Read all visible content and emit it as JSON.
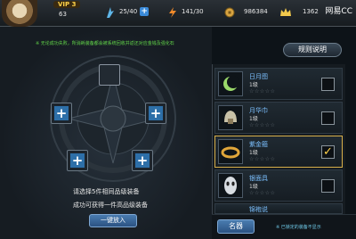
{
  "header": {
    "vip": "VIP 3",
    "level": "63",
    "stamina": "25/40",
    "energy": "141/30",
    "gold": "986384",
    "diamonds": "1362",
    "plus": "+",
    "watermark": "网易CC"
  },
  "forge": {
    "notice": "※ 无论成功失败，所消耗装备都会被系统回收并返还对应金钱及强化石",
    "tip_line1": "请选择5件相同品级装备",
    "tip_line2": "成功可获得一件高品级装备",
    "place_button": "一键放入",
    "slot_plus": "+"
  },
  "rules_button": "规则说明",
  "equipment_list": [
    {
      "name": "日月图",
      "level": "1级",
      "stars": "☆☆☆☆☆",
      "checked": false,
      "check": ""
    },
    {
      "name": "月华巾",
      "level": "1级",
      "stars": "☆☆☆☆☆",
      "checked": false,
      "check": ""
    },
    {
      "name": "紫金箍",
      "level": "1级",
      "stars": "☆☆☆☆☆",
      "checked": true,
      "check": "✓"
    },
    {
      "name": "银面具",
      "level": "1级",
      "stars": "☆☆☆☆☆",
      "checked": false,
      "check": ""
    },
    {
      "name": "锦袍说",
      "level": "1级",
      "stars": "",
      "checked": false,
      "check": ""
    }
  ],
  "bottom": {
    "name_button": "名器",
    "note": "※ 已锁定的装备不显示"
  },
  "colors": {
    "accent_blue": "#2d6fa8",
    "selected_border": "#d9b04a",
    "notice_green": "#63d84a",
    "item_name_blue": "#7cc0ff"
  }
}
